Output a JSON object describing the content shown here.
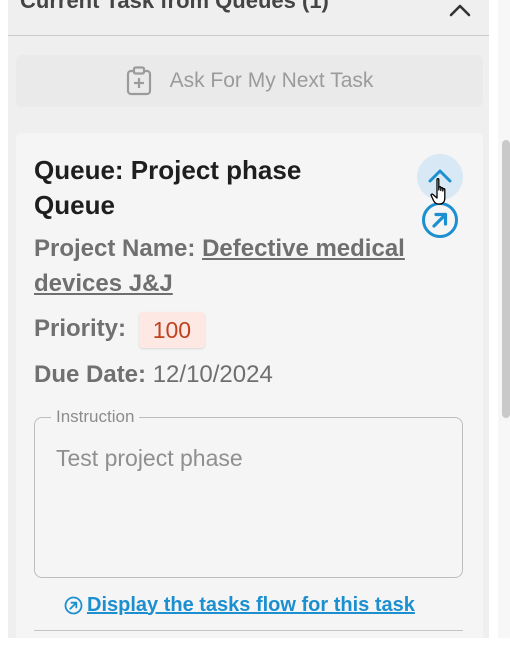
{
  "panel": {
    "title": "Current Task from Queues (1)",
    "collapse_icon": "chevron-up-icon"
  },
  "next_task_button": {
    "label": "Ask For My Next Task",
    "icon": "clipboard-plus-icon"
  },
  "task": {
    "queue_title": "Queue: Project phase Queue",
    "project_name_label": "Project Name:",
    "project_name_value": "Defective medical devices J&J",
    "priority_label": "Priority:",
    "priority_value": "100",
    "due_date_label": "Due Date:",
    "due_date_value": "12/10/2024",
    "instruction_label": "Instruction",
    "instruction_text": "Test project phase",
    "flow_link_label": "Display the tasks flow for this task",
    "icons": {
      "collapse": "chevron-up-icon",
      "open": "arrow-up-right-circle-icon",
      "flow": "arrow-up-right-circle-icon"
    }
  },
  "colors": {
    "accent": "#1c8fd0",
    "priority_bg": "#fde8e4",
    "priority_text": "#c0421f"
  }
}
